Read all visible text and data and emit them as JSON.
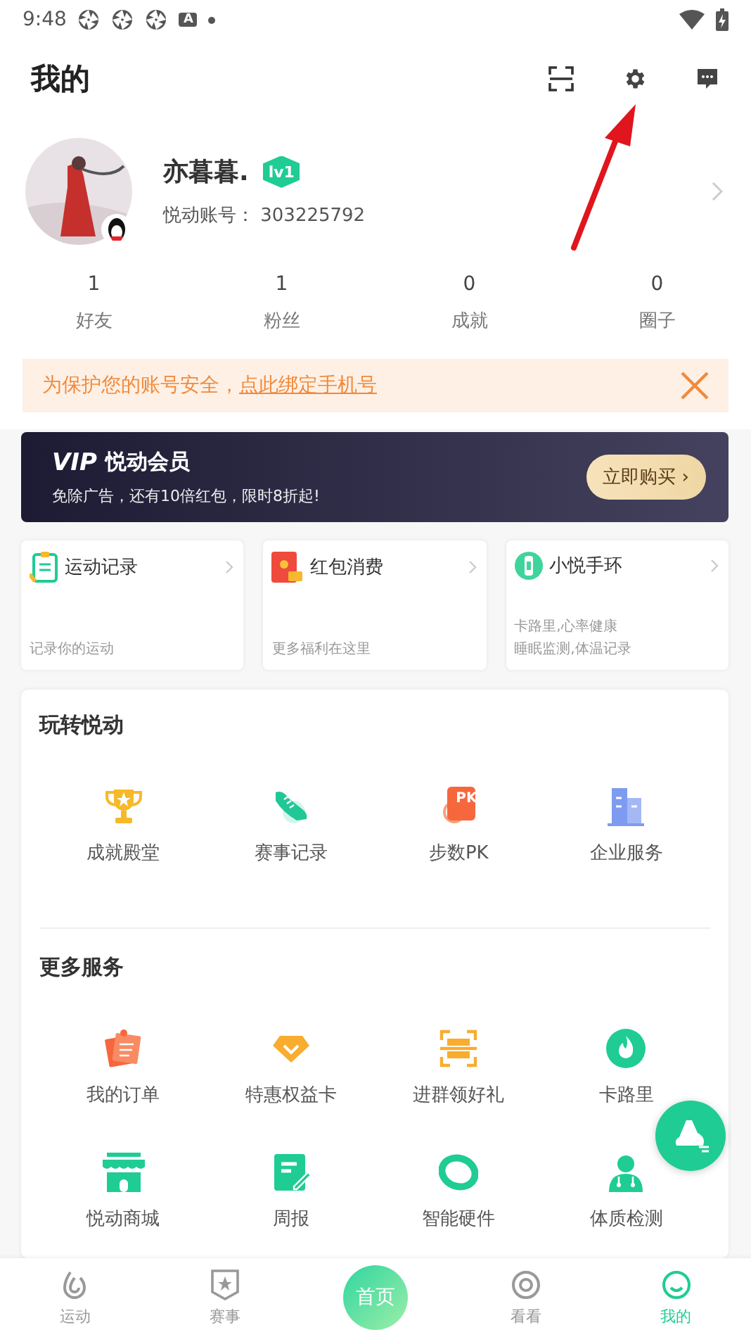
{
  "status_bar": {
    "time": "9:48",
    "notif_letter": "A"
  },
  "header": {
    "title": "我的"
  },
  "profile": {
    "name": "亦暮暮.",
    "level_badge": "lv1",
    "account_label": "悦动账号：",
    "account_id": "303225792"
  },
  "stats": [
    {
      "value": "1",
      "label": "好友"
    },
    {
      "value": "1",
      "label": "粉丝"
    },
    {
      "value": "0",
      "label": "成就"
    },
    {
      "value": "0",
      "label": "圈子"
    }
  ],
  "notice": {
    "text": "为保护您的账号安全，",
    "link": "点此绑定手机号"
  },
  "vip": {
    "logo": "VIP",
    "title": "悦动会员",
    "subtitle": "免除广告，还有10倍红包，限时8折起!",
    "button": "立即购买 ›"
  },
  "cards": [
    {
      "kind": "clipboard",
      "title": "运动记录",
      "lines": [
        "记录你的运动"
      ]
    },
    {
      "kind": "redpacket",
      "title": "红包消费",
      "lines": [
        "更多福利在这里"
      ]
    },
    {
      "kind": "band",
      "title": "小悦手环",
      "lines": [
        "卡路里,心率健康",
        "睡眠监测,体温记录"
      ]
    }
  ],
  "sections": [
    {
      "title": "玩转悦动",
      "items": [
        {
          "kind": "trophy",
          "label": "成就殿堂"
        },
        {
          "kind": "shoe",
          "label": "赛事记录"
        },
        {
          "kind": "pk",
          "label": "步数PK",
          "badge": "PK"
        },
        {
          "kind": "building",
          "label": "企业服务"
        }
      ]
    },
    {
      "title": "更多服务",
      "items": [
        {
          "kind": "notes",
          "label": "我的订单"
        },
        {
          "kind": "diamond",
          "label": "特惠权益卡"
        },
        {
          "kind": "scan",
          "label": "进群领好礼"
        },
        {
          "kind": "flame",
          "label": "卡路里"
        },
        {
          "kind": "shop",
          "label": "悦动商城"
        },
        {
          "kind": "report",
          "label": "周报"
        },
        {
          "kind": "ring",
          "label": "智能硬件"
        },
        {
          "kind": "doctor",
          "label": "体质检测"
        }
      ]
    }
  ],
  "tabs": [
    {
      "kind": "drop",
      "label": "运动",
      "selected": false
    },
    {
      "kind": "badge",
      "label": "赛事",
      "selected": false
    },
    {
      "kind": "home",
      "label": "首页",
      "selected": false
    },
    {
      "kind": "eye",
      "label": "看看",
      "selected": false
    },
    {
      "kind": "person",
      "label": "我的",
      "selected": true
    }
  ]
}
